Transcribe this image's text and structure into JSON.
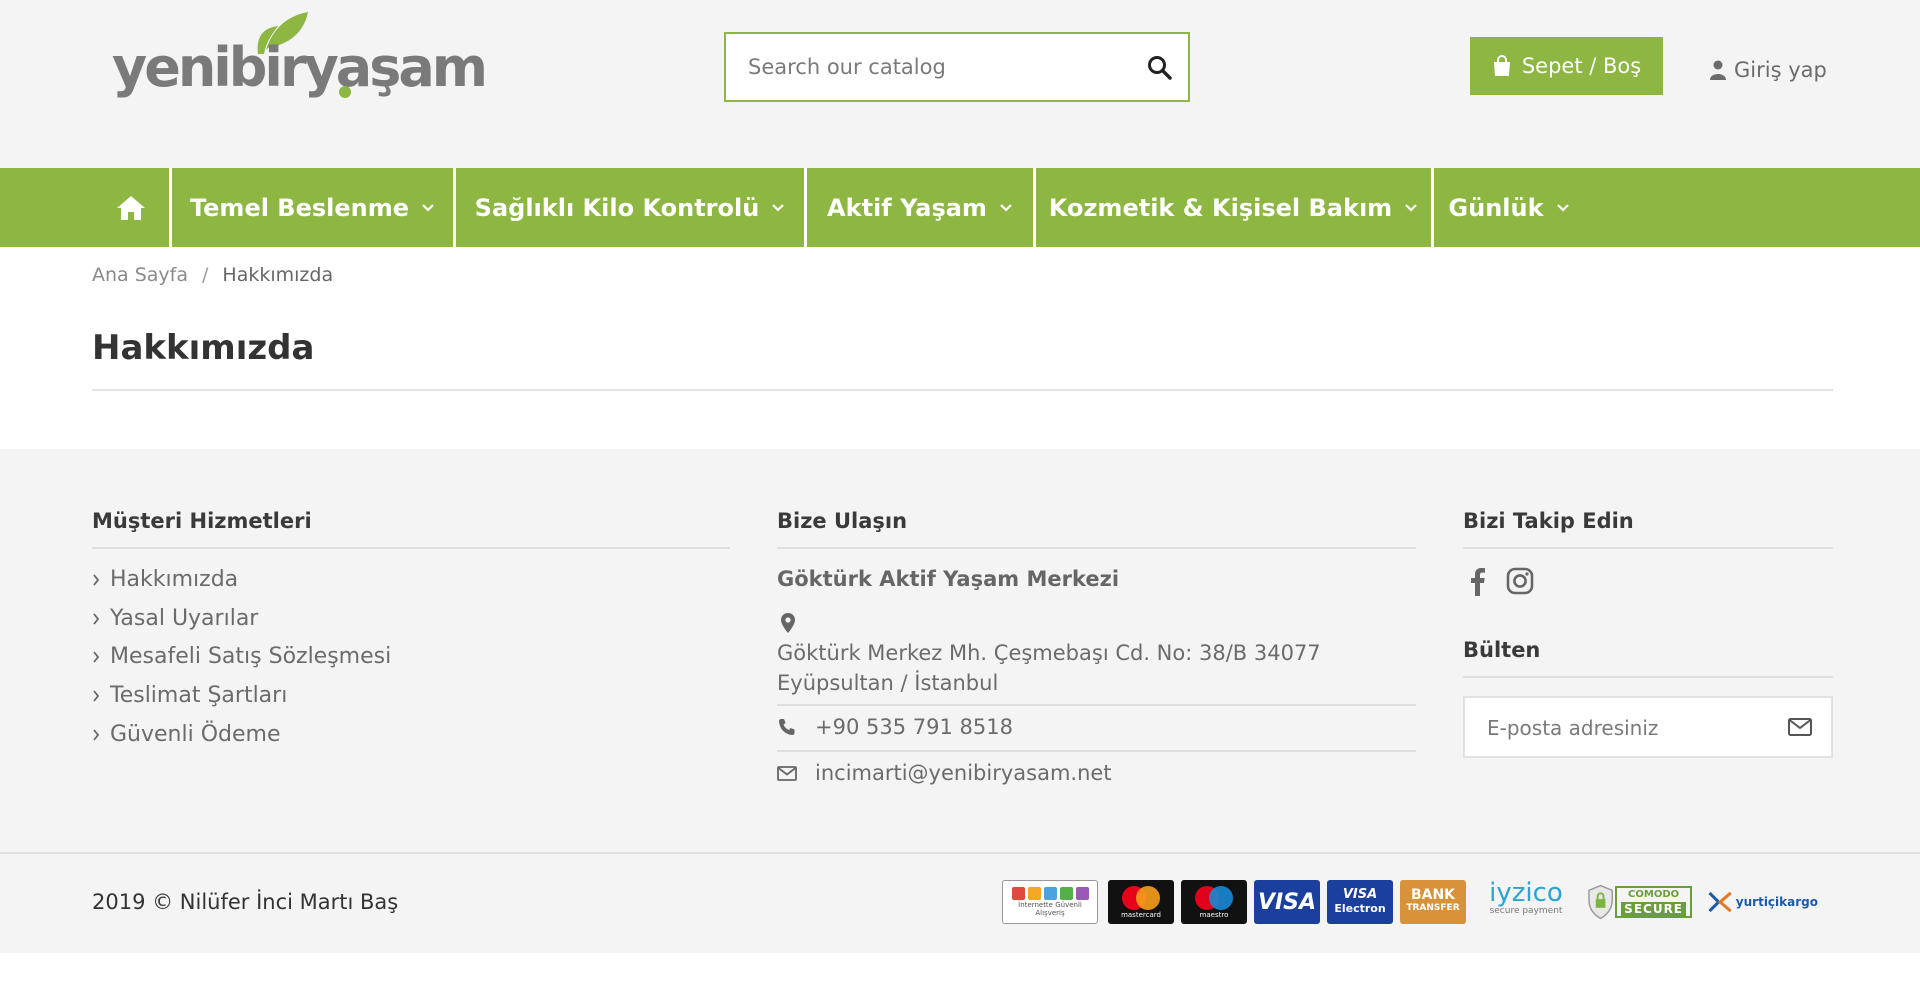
{
  "header": {
    "logo_text": "yenibiryaşam",
    "search_placeholder": "Search our catalog",
    "cart_label": "Sepet / Boş",
    "login_label": "Giriş yap"
  },
  "nav": {
    "items": [
      {
        "label": "Temel Beslenme"
      },
      {
        "label": "Sağlıklı Kilo Kontrolü"
      },
      {
        "label": "Aktif Yaşam"
      },
      {
        "label": "Kozmetik & Kişisel Bakım"
      },
      {
        "label": "Günlük"
      }
    ]
  },
  "breadcrumb": {
    "home": "Ana Sayfa",
    "separator": "/",
    "current": "Hakkımızda"
  },
  "page": {
    "title": "Hakkımızda"
  },
  "footer": {
    "customer_service": {
      "heading": "Müşteri Hizmetleri",
      "links": [
        "Hakkımızda",
        "Yasal Uyarılar",
        "Mesafeli Satış Sözleşmesi",
        "Teslimat Şartları",
        "Güvenli Ödeme"
      ]
    },
    "contact": {
      "heading": "Bize Ulaşın",
      "name": "Göktürk Aktif Yaşam Merkezi",
      "address_line1": "Göktürk Merkez Mh. Çeşmebaşı Cd. No: 38/B 34077",
      "address_line2": "Eyüpsultan / İstanbul",
      "phone": "+90 535 791 8518",
      "email": "incimarti@yenibiryasam.net"
    },
    "follow": {
      "heading": "Bizi Takip Edin",
      "icons": [
        "facebook-icon",
        "instagram-icon"
      ]
    },
    "newsletter": {
      "heading": "Bülten",
      "placeholder": "E-posta adresiniz"
    },
    "copyright": "2019 © Nilüfer İnci Martı Baş",
    "payment": {
      "trust_text": "İnternette Güvenli Alışveriş",
      "mastercard": "mastercard",
      "maestro": "maestro",
      "visa": "VISA",
      "visa_electron_top": "VISA",
      "visa_electron_bottom": "Electron",
      "bank_top": "BANK",
      "bank_bottom": "TRANSFER",
      "iyzico": "iyzico",
      "iyzico_sub": "secure payment",
      "comodo_top": "COMODO",
      "comodo_bottom": "SECURE",
      "yurtici": "yurtiçikargo"
    }
  },
  "colors": {
    "brand_green": "#8db642",
    "text_gray": "#6b6b6b",
    "bg_light": "#f4f4f4"
  }
}
